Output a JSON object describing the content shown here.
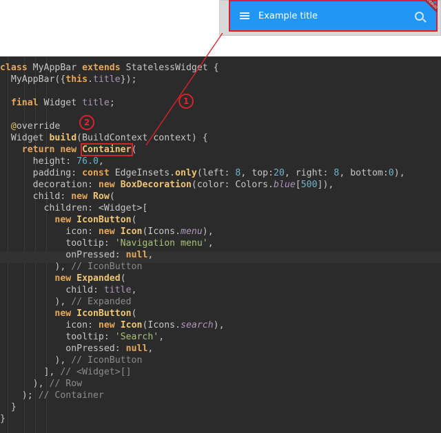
{
  "preview": {
    "title": "Example title",
    "menu_icon": "menu-icon",
    "search_icon": "search-icon",
    "banner": "DEBUG",
    "appbar_color": "#2196f3"
  },
  "markers": [
    "1",
    "2"
  ],
  "code": {
    "l1": [
      "class ",
      "MyAppBar ",
      "extends ",
      "StatelessWidget {"
    ],
    "l2": [
      "  MyAppBar({",
      "this",
      ".",
      "title",
      "});"
    ],
    "l4": [
      "  ",
      "final ",
      "Widget ",
      "title",
      ";"
    ],
    "l6": [
      "  ",
      "@",
      "override"
    ],
    "l7": [
      "  Widget ",
      "build",
      "(BuildContext context) {"
    ],
    "l8": [
      "    ",
      "return new ",
      "Container",
      "("
    ],
    "l9": [
      "      height: ",
      "76.0",
      ","
    ],
    "l10": [
      "      padding: ",
      "const ",
      "EdgeInsets.",
      "only",
      "(left: ",
      "8",
      ", top:",
      "20",
      ", right: ",
      "8",
      ", bottom:",
      "0",
      "),"
    ],
    "l11": [
      "      decoration: ",
      "new ",
      "BoxDecoration",
      "(color: Colors.",
      "blue",
      "[",
      "500",
      "]),"
    ],
    "l12": [
      "      child: ",
      "new ",
      "Row",
      "("
    ],
    "l13": [
      "        children: <Widget>["
    ],
    "l14": [
      "          ",
      "new ",
      "IconButton",
      "("
    ],
    "l15": [
      "            icon: ",
      "new ",
      "Icon",
      "(Icons.",
      "menu",
      "),"
    ],
    "l16": [
      "            tooltip: ",
      "'Navigation menu'",
      ","
    ],
    "l17": [
      "            onPressed: ",
      "null",
      ","
    ],
    "l18": [
      "          ), ",
      "// IconButton"
    ],
    "l19": [
      "          ",
      "new ",
      "Expanded",
      "("
    ],
    "l20": [
      "            child: ",
      "title",
      ","
    ],
    "l21": [
      "          ), ",
      "// Expanded"
    ],
    "l22": [
      "          ",
      "new ",
      "IconButton",
      "("
    ],
    "l23": [
      "            icon: ",
      "new ",
      "Icon",
      "(Icons.",
      "search",
      "),"
    ],
    "l24": [
      "            tooltip: ",
      "'Search'",
      ","
    ],
    "l25": [
      "            onPressed: ",
      "null",
      ","
    ],
    "l26": [
      "          ), ",
      "// IconButton"
    ],
    "l27": [
      "        ], ",
      "// <Widget>[]"
    ],
    "l28": [
      "      ), ",
      "// Row"
    ],
    "l29": [
      "    ); ",
      "// Container"
    ],
    "l30": [
      "  }"
    ],
    "l31": [
      "}"
    ]
  }
}
